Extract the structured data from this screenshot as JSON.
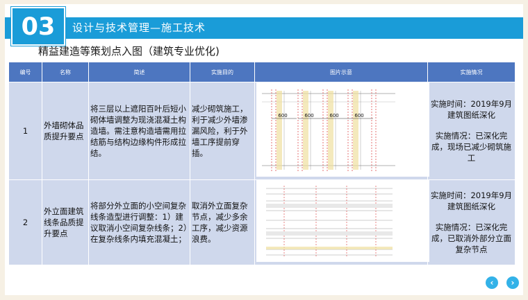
{
  "header": {
    "number": "03",
    "title": "设计与技术管理—施工技术"
  },
  "subtitle": "精益建造等策划点入图（建筑专业优化)",
  "table": {
    "columns": [
      "编号",
      "名称",
      "简述",
      "实施目的",
      "图片示意",
      "实施情况"
    ],
    "rows": [
      {
        "num": "1",
        "name": "外墙砌体品质提升要点",
        "desc": "将三层以上遮阳百叶后短小砌体墙调整为现浇混凝土构造墙。需注意构造墙需用拉结筋与结构边缘构件形成拉结。",
        "purpose": "减少砌筑施工，利于减少外墙渗漏风险，利于外墙工序提前穿插。",
        "figure_labels": [
          "600",
          "600",
          "600",
          "600"
        ],
        "impl_time": "实施时间：2019年9月建筑图纸深化",
        "impl_status": "实施情况：已深化完成，现场已减少砌筑施工"
      },
      {
        "num": "2",
        "name": "外立面建筑线条品质提升要点",
        "desc": "将部分外立面的小空间复杂线条造型进行调整：1）建议取消小空间复杂线条；2）在复杂线条内填充混凝土；",
        "purpose": "取消外立面复杂节点，减少多余工序，减少资源浪费。",
        "impl_time": "实施时间：2019年9月建筑图纸深化",
        "impl_status": "实施情况：已深化完成，已取消外部分立面复杂节点"
      }
    ]
  },
  "nav": {
    "prev": "‹",
    "next": "›"
  },
  "colors": {
    "accent": "#1a9cd8",
    "table_header": "#4d76c0",
    "table_cell": "#cfd8ec",
    "drawing_red": "#e05050"
  }
}
